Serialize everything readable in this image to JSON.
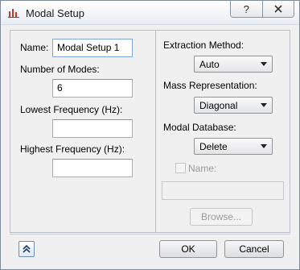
{
  "window": {
    "title": "Modal Setup",
    "icon": "chart-icon",
    "help_label": "?",
    "close_label": "X"
  },
  "left": {
    "name_label": "Name:",
    "name_value": "Modal Setup 1",
    "modes_label": "Number of Modes:",
    "modes_value": "6",
    "lowest_label": "Lowest Frequency (Hz):",
    "lowest_value": "",
    "highest_label": "Highest Frequency (Hz):",
    "highest_value": ""
  },
  "right": {
    "extraction_label": "Extraction Method:",
    "extraction_value": "Auto",
    "mass_label": "Mass Representation:",
    "mass_value": "Diagonal",
    "db_label": "Modal Database:",
    "db_value": "Delete",
    "db_name_label": "Name:",
    "db_name_value": "",
    "browse_label": "Browse..."
  },
  "footer": {
    "ok_label": "OK",
    "cancel_label": "Cancel"
  }
}
